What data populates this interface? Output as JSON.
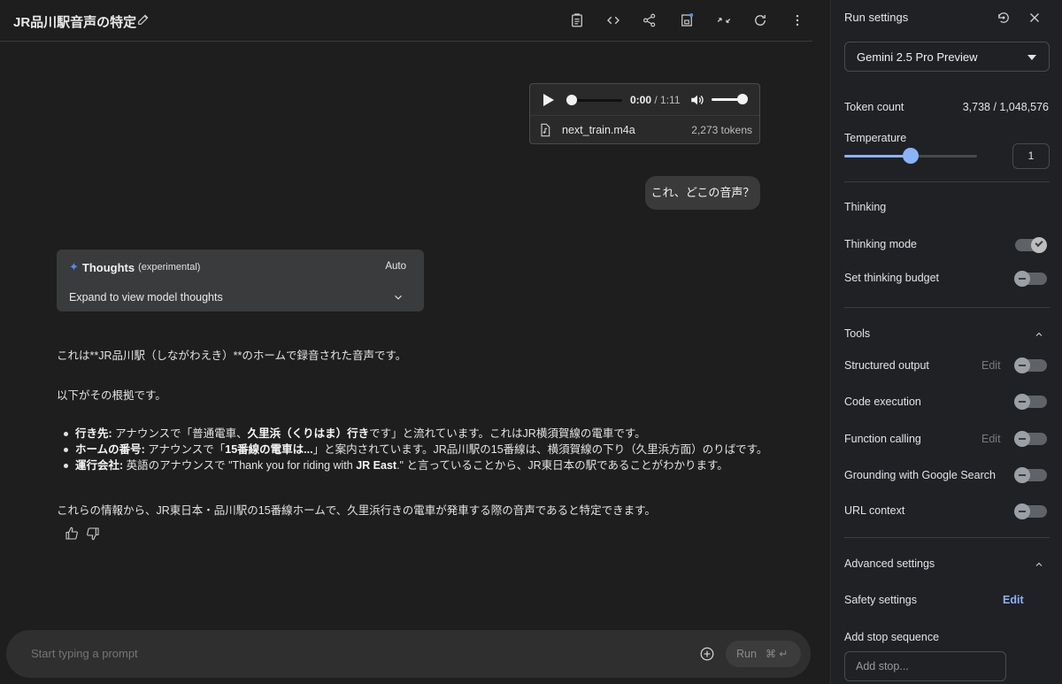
{
  "header": {
    "title": "JR品川駅音声の特定",
    "icons": [
      "edit-icon",
      "notes-icon",
      "code-icon",
      "share-icon",
      "save-icon",
      "compare-icon",
      "refresh-icon",
      "more-icon"
    ]
  },
  "audio": {
    "time_current": "0:00",
    "time_separator": " / ",
    "time_total": "1:11",
    "file_name": "next_train.m4a",
    "file_tokens": "2,273 tokens",
    "volume_level": 0.92
  },
  "user_message": "これ、どこの音声？",
  "thoughts": {
    "title": "Thoughts",
    "tag": "(experimental)",
    "mode": "Auto",
    "expand_label": "Expand to view model thoughts"
  },
  "answer": {
    "p1": "これは**JR品川駅（しながわえき）**のホームで録音された音声です。",
    "p2": "以下がその根拠です。",
    "items": [
      {
        "label": "行き先:",
        "pre": " アナウンスで「普通電車、",
        "bold": "久里浜（くりはま）行き",
        "post": "です」と流れています。これはJR横須賀線の電車です。"
      },
      {
        "label": "ホームの番号:",
        "pre": " アナウンスで「",
        "bold": "15番線の電車は...",
        "post": "」と案内されています。JR品川駅の15番線は、横須賀線の下り（久里浜方面）のりばです。"
      },
      {
        "label": "運行会社:",
        "pre": " 英語のアナウンスで \"Thank you for riding with ",
        "bold": "JR East",
        "post": ".\" と言っていることから、JR東日本の駅であることがわかります。"
      }
    ],
    "p3": "これらの情報から、JR東日本・品川駅の15番線ホームで、久里浜行きの電車が発車する際の音声であると特定できます。"
  },
  "prompt": {
    "placeholder": "Start typing a prompt",
    "run_label": "Run",
    "run_keys": "⌘ ↵"
  },
  "settings": {
    "title": "Run settings",
    "model": "Gemini 2.5 Pro Preview",
    "token_count_label": "Token count",
    "token_count_value": "3,738 / 1,048,576",
    "temperature_label": "Temperature",
    "temperature_value": "1",
    "temperature_fraction": 0.5,
    "thinking_header": "Thinking",
    "thinking_mode_label": "Thinking mode",
    "thinking_mode_on": true,
    "thinking_budget_label": "Set thinking budget",
    "thinking_budget_on": false,
    "tools_header": "Tools",
    "structured_output_label": "Structured output",
    "code_execution_label": "Code execution",
    "function_calling_label": "Function calling",
    "grounding_label": "Grounding with Google Search",
    "url_context_label": "URL context",
    "edit_label": "Edit",
    "advanced_header": "Advanced settings",
    "safety_label": "Safety settings",
    "safety_edit": "Edit",
    "stop_sequence_label": "Add stop sequence",
    "stop_placeholder": "Add stop..."
  }
}
